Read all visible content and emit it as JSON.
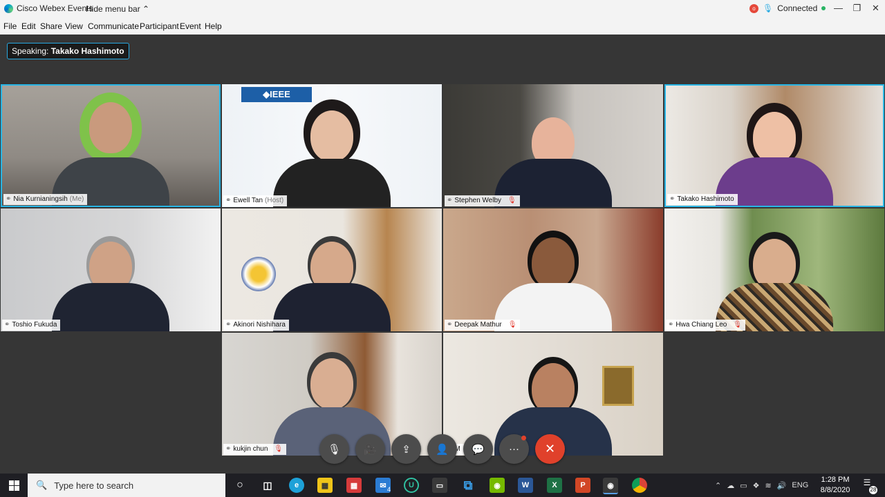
{
  "app": {
    "title": "Cisco Webex Events",
    "hide_menu_label": "Hide menu bar ⌃",
    "status": "Connected",
    "rec_label": "o"
  },
  "window_controls": {
    "minimize": "—",
    "restore": "❐",
    "close": "✕"
  },
  "menu": [
    "File",
    "Edit",
    "Share",
    "View",
    "Communicate",
    "Participant",
    "Event",
    "Help"
  ],
  "speaking": {
    "prefix": "Speaking:",
    "name": "Takako Hashimoto"
  },
  "participants": [
    {
      "name": "Nia Kurnianingsih",
      "suffix": "(Me)",
      "muted": false
    },
    {
      "name": "Ewell Tan",
      "suffix": "(Host)",
      "muted": false
    },
    {
      "name": "Stephen Welby",
      "suffix": "",
      "muted": true
    },
    {
      "name": "Takako Hashimoto",
      "suffix": "",
      "muted": false
    },
    {
      "name": "Toshio Fukuda",
      "suffix": "",
      "muted": false
    },
    {
      "name": "Akinori Nishihara",
      "suffix": "",
      "muted": false
    },
    {
      "name": "Deepak Mathur",
      "suffix": "",
      "muted": true
    },
    {
      "name": "Hwa Chiang Leo",
      "suffix": "",
      "muted": true
    },
    {
      "name": "kukjin chun",
      "suffix": "",
      "muted": true
    },
    {
      "name": "M",
      "suffix": "",
      "muted": true
    }
  ],
  "ieee_logo": "◆IEEE",
  "controls": {
    "mute": "🎙",
    "video": "🎥",
    "share": "⇪",
    "participants": "👤",
    "chat": "💬",
    "more": "···",
    "leave": "✕"
  },
  "taskbar": {
    "search_placeholder": "Type here to search",
    "tray_lang": "ENG",
    "time": "1:28 PM",
    "date": "8/8/2020",
    "notification_count": "28",
    "mail_badge": "4"
  },
  "colors": {
    "accent": "#27b6e6",
    "leave": "#e0412b",
    "muted": "#e2362b"
  }
}
